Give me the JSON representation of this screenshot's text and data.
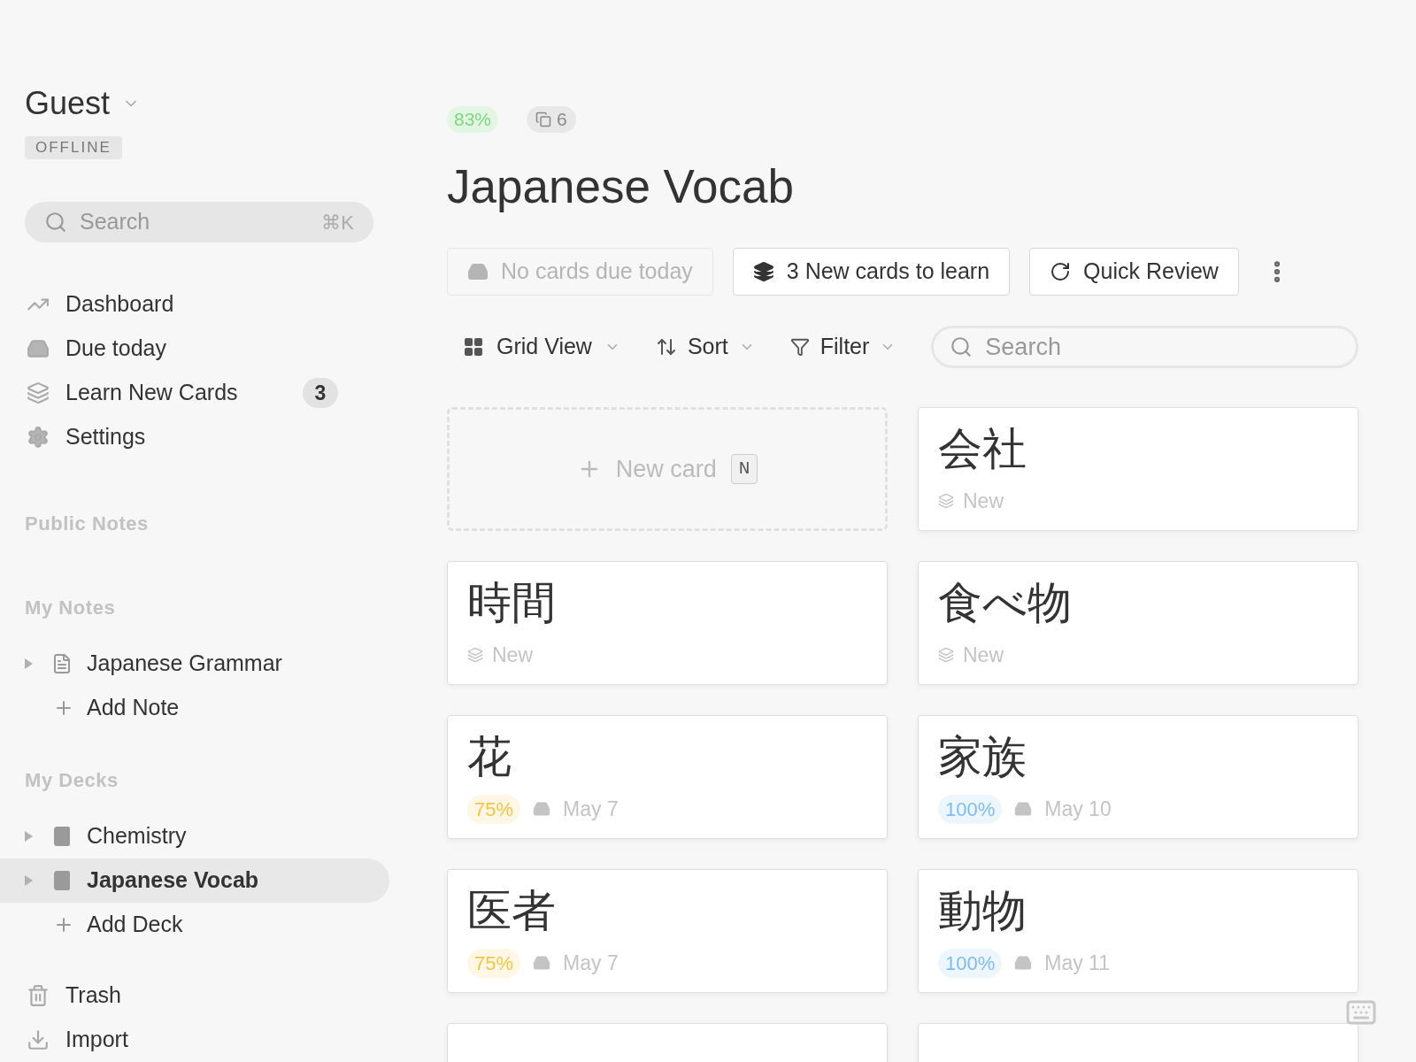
{
  "user": {
    "name": "Guest",
    "status": "OFFLINE"
  },
  "sidebar_search": {
    "placeholder": "Search",
    "shortcut": "⌘K"
  },
  "nav": [
    {
      "kind": "dashboard",
      "label": "Dashboard"
    },
    {
      "kind": "due",
      "label": "Due today"
    },
    {
      "kind": "learn",
      "label": "Learn New Cards",
      "count": "3"
    },
    {
      "kind": "settings",
      "label": "Settings"
    }
  ],
  "public_notes": {
    "heading": "Public Notes"
  },
  "my_notes": {
    "heading": "My Notes",
    "items": [
      {
        "kind": "note",
        "label": "Japanese Grammar",
        "expanded": false,
        "selected": false
      }
    ],
    "add": "Add Note"
  },
  "my_decks": {
    "heading": "My Decks",
    "items": [
      {
        "kind": "deck",
        "label": "Chemistry",
        "expanded": false,
        "selected": false
      },
      {
        "kind": "deck",
        "label": "Japanese Vocab",
        "expanded": false,
        "selected": true
      }
    ],
    "add": "Add Deck"
  },
  "footer_nav": [
    {
      "kind": "trash",
      "label": "Trash"
    },
    {
      "kind": "import",
      "label": "Import"
    }
  ],
  "deck": {
    "score": "83%",
    "card_count": "6",
    "title": "Japanese Vocab"
  },
  "actions": [
    {
      "kind": "due",
      "label": "No cards due today",
      "disabled": true
    },
    {
      "kind": "learn",
      "label": "3 New cards to learn",
      "disabled": false
    },
    {
      "kind": "review",
      "label": "Quick Review",
      "disabled": false
    }
  ],
  "toolbar": {
    "view": "Grid View",
    "sort": "Sort",
    "filter": "Filter",
    "search_placeholder": "Search"
  },
  "new_card": {
    "label": "New card",
    "shortcut": "N"
  },
  "cards": [
    {
      "kind": "new",
      "front": "会社",
      "status": "New"
    },
    {
      "kind": "new",
      "front": "時間",
      "status": "New"
    },
    {
      "kind": "new",
      "front": "食べ物",
      "status": "New"
    },
    {
      "kind": "review",
      "front": "花",
      "score": "75%",
      "color": "#f5c542",
      "due": "May 7"
    },
    {
      "kind": "review",
      "front": "家族",
      "score": "100%",
      "color": "#7fbcf2",
      "due": "May 10"
    },
    {
      "kind": "review",
      "front": "医者",
      "score": "75%",
      "color": "#f5c542",
      "due": "May 7"
    },
    {
      "kind": "review",
      "front": "動物",
      "score": "100%",
      "color": "#7fbcf2",
      "due": "May 11"
    },
    {
      "kind": "cut"
    },
    {
      "kind": "cut"
    }
  ]
}
